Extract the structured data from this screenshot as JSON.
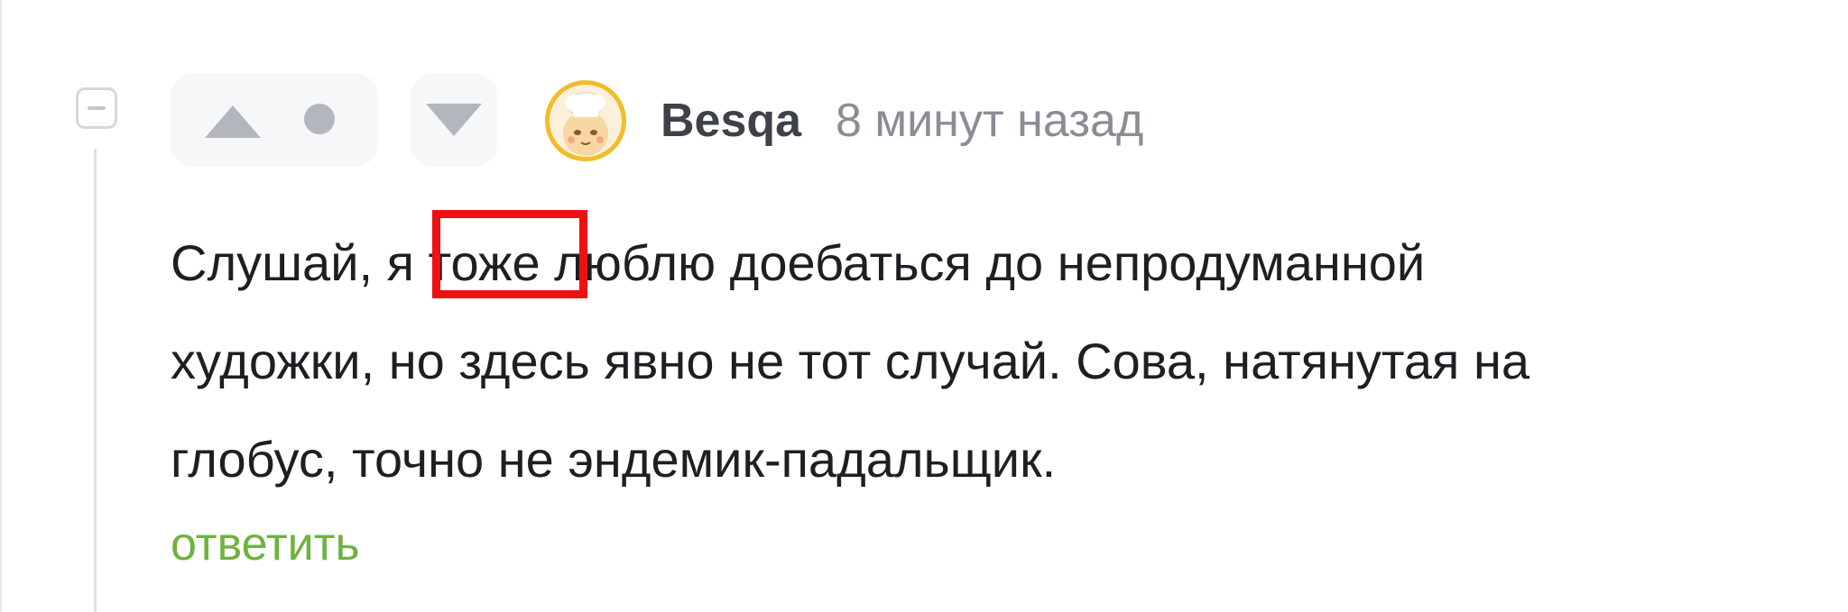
{
  "comment": {
    "author": "Besqa",
    "time": "8 минут назад",
    "avatar_icon": "chef-avatar",
    "text_lines": [
      "Слушай, я тоже люблю доебаться до непродуманной",
      "художки, но здесь явно не тот случай.  Сова, натянутая на",
      "глобус, точно не эндемик-падальщик."
    ],
    "highlighted_word": "тоже",
    "reply_label": "ответить"
  },
  "colors": {
    "highlight": "#ee1111",
    "reply": "#6db33f",
    "avatar_ring": "#f2bd2b",
    "vote_icon": "#b3b6bd"
  }
}
